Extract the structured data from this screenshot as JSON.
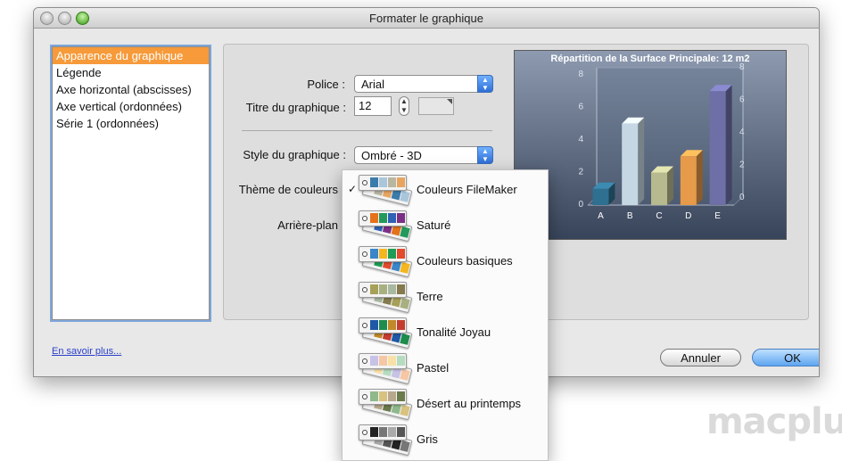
{
  "window": {
    "title": "Formater le graphique"
  },
  "categories": [
    {
      "label": "Apparence du graphique",
      "selected": true
    },
    {
      "label": "Légende"
    },
    {
      "label": "Axe horizontal (abscisses)"
    },
    {
      "label": "Axe vertical (ordonnées)"
    },
    {
      "label": "Série 1 (ordonnées)"
    }
  ],
  "help_link": "En savoir plus...",
  "form": {
    "font_label": "Police :",
    "font_value": "Arial",
    "title_label": "Titre du graphique :",
    "title_size": "12",
    "style_label": "Style du graphique :",
    "style_value": "Ombré - 3D",
    "theme_label": "Thème de couleurs",
    "background_label": "Arrière-plan"
  },
  "preview": {
    "chart_data": {
      "type": "bar",
      "title": "Répartition de la Surface Principale: 12 m2",
      "categories": [
        "A",
        "B",
        "C",
        "D",
        "E"
      ],
      "values": [
        1,
        5,
        2,
        3,
        7
      ],
      "ylim": [
        0,
        8
      ],
      "left_ticks": [
        "8",
        "6",
        "4",
        "2",
        "0"
      ],
      "right_ticks": [
        "8",
        "6",
        "4",
        "2",
        "0"
      ],
      "colors": [
        "#2f6f8f",
        "#c4d7e3",
        "#b7b98e",
        "#e69a4a",
        "#6f6fa8"
      ]
    }
  },
  "menu": {
    "items": [
      {
        "label": "Couleurs FileMaker",
        "checked": "✓",
        "colors": [
          "#3b7cab",
          "#a9c6db",
          "#b9b6a2",
          "#e7a560"
        ]
      },
      {
        "label": "Saturé",
        "checked": "",
        "colors": [
          "#e4731b",
          "#239a5c",
          "#2f62b4",
          "#7b2f86"
        ]
      },
      {
        "label": "Couleurs basiques",
        "checked": "",
        "colors": [
          "#3b86c8",
          "#f4b720",
          "#1f9d56",
          "#e24b2c"
        ]
      },
      {
        "label": "Terre",
        "checked": "",
        "colors": [
          "#a7a058",
          "#a8b082",
          "#a9b8a0",
          "#847a4c"
        ]
      },
      {
        "label": "Tonalité Joyau",
        "checked": "",
        "colors": [
          "#1f58a6",
          "#1e8c4c",
          "#c2892b",
          "#c53c2f"
        ]
      },
      {
        "label": "Pastel",
        "checked": "",
        "colors": [
          "#c7c2e6",
          "#f6c7a4",
          "#f8e0a8",
          "#b6dcc0"
        ]
      },
      {
        "label": "Désert au printemps",
        "checked": "",
        "colors": [
          "#8fb98c",
          "#d9c27f",
          "#b8a88d",
          "#6a7a4b"
        ]
      },
      {
        "label": "Gris",
        "checked": "",
        "colors": [
          "#222222",
          "#777777",
          "#aaaaaa",
          "#555555"
        ]
      }
    ]
  },
  "buttons": {
    "cancel": "Annuler",
    "ok": "OK"
  },
  "watermark": "macplus"
}
